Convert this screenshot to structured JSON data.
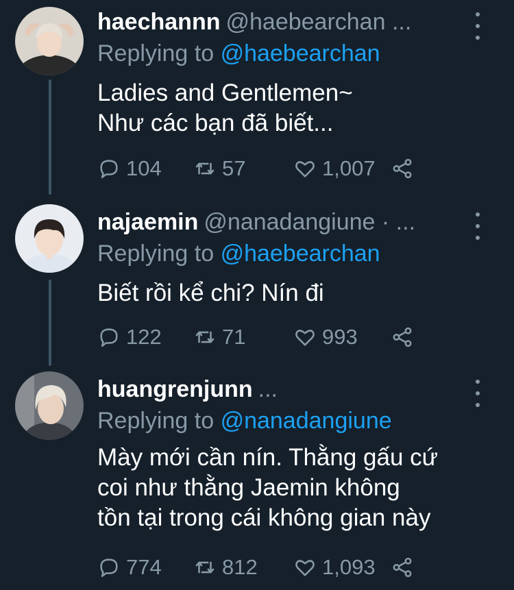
{
  "tweets": [
    {
      "display_name": "haechannn",
      "handle": "@haebearchan ...",
      "replying_label": "Replying to",
      "replying_handle": "@haebearchan",
      "text": "Ladies and Gentlemen~\nNhư các bạn đã biết...",
      "replies": "104",
      "retweets": "57",
      "likes": "1,007",
      "avatar_colors": {
        "bg": "#d9d4cc",
        "hair": "#e6e0d6",
        "skin": "#f0d9c6",
        "shirt": "#2a2a2a"
      }
    },
    {
      "display_name": "najaemin",
      "handle": "@nanadangiune · ...",
      "replying_label": "Replying to",
      "replying_handle": "@haebearchan",
      "text": "Biết rồi kể chi? Nín đi",
      "replies": "122",
      "retweets": "71",
      "likes": "993",
      "avatar_colors": {
        "bg": "#e9ecf1",
        "hair": "#2b2222",
        "skin": "#f3dccb",
        "shirt": "#dfe6ef"
      }
    },
    {
      "display_name": "huangrenjunn",
      "handle": "...",
      "replying_label": "Replying to",
      "replying_handle": "@nanadangiune",
      "text": "Mày mới cần nín. Thằng gấu cứ\ncoi như thằng Jaemin không\ntồn tại trong cái không gian này",
      "replies": "774",
      "retweets": "812",
      "likes": "1,093",
      "avatar_colors": {
        "bg": "#6b6f76",
        "hair": "#e8e2d8",
        "skin": "#e9d2c0",
        "shirt": "#3a3d44"
      }
    }
  ],
  "colors": {
    "background": "#15202b",
    "secondary_text": "#8899a6",
    "link": "#1da1f2",
    "thread_line": "#3d5466"
  }
}
